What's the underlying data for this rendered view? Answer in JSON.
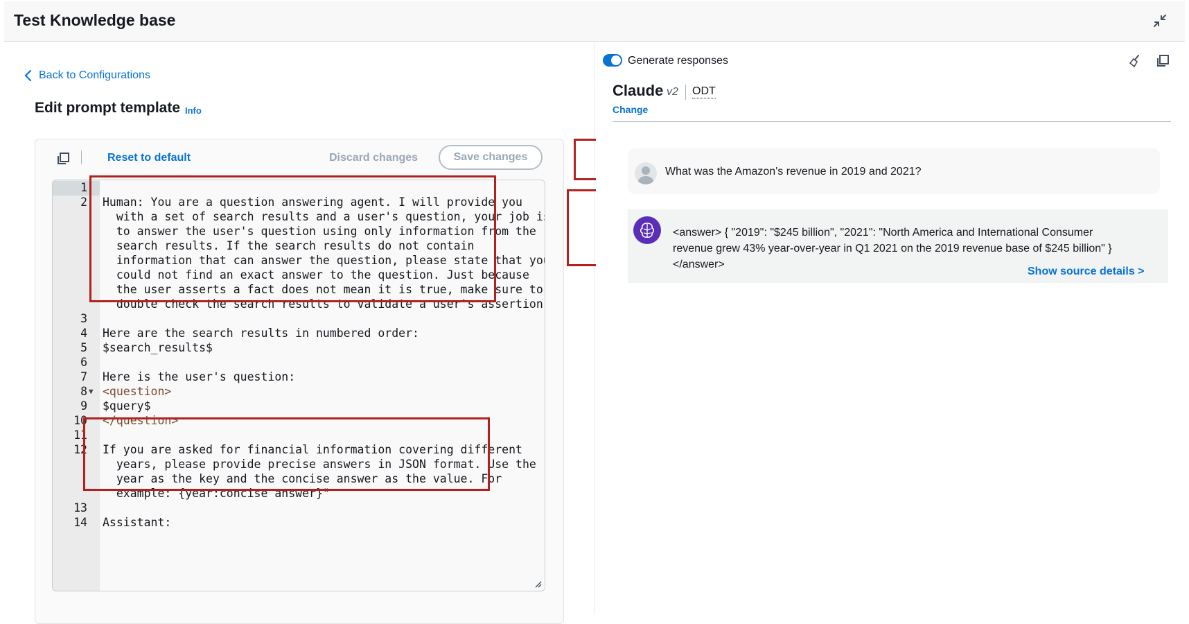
{
  "header": {
    "title": "Test Knowledge base"
  },
  "left": {
    "back_label": "Back to Configurations",
    "edit_title": "Edit prompt template",
    "info_label": "Info",
    "reset_label": "Reset to default",
    "discard_label": "Discard changes",
    "save_label": "Save changes"
  },
  "editor": {
    "lines": [
      {
        "n": "1",
        "text": ""
      },
      {
        "n": "2",
        "text": "Human: You are a question answering agent. I will provide you"
      },
      {
        "n": "",
        "text": "  with a set of search results and a user's question, your job is"
      },
      {
        "n": "",
        "text": "  to answer the user's question using only information from the"
      },
      {
        "n": "",
        "text": "  search results. If the search results do not contain"
      },
      {
        "n": "",
        "text": "  information that can answer the question, please state that you"
      },
      {
        "n": "",
        "text": "  could not find an exact answer to the question. Just because"
      },
      {
        "n": "",
        "text": "  the user asserts a fact does not mean it is true, make sure to"
      },
      {
        "n": "",
        "text": "  double check the search results to validate a user's assertion."
      },
      {
        "n": "3",
        "text": ""
      },
      {
        "n": "4",
        "text": "Here are the search results in numbered order:"
      },
      {
        "n": "5",
        "text": "$search_results$"
      },
      {
        "n": "6",
        "text": ""
      },
      {
        "n": "7",
        "text": "Here is the user's question:"
      },
      {
        "n": "8",
        "text": "<question>"
      },
      {
        "n": "9",
        "text": "$query$"
      },
      {
        "n": "10",
        "text": "</question>"
      },
      {
        "n": "11",
        "text": ""
      },
      {
        "n": "12",
        "text": "If you are asked for financial information covering different"
      },
      {
        "n": "",
        "text": "  years, please provide precise answers in JSON format. Use the"
      },
      {
        "n": "",
        "text": "  year as the key and the concise answer as the value. For"
      },
      {
        "n": "",
        "text": "  example: {year:concise answer}\""
      },
      {
        "n": "13",
        "text": ""
      },
      {
        "n": "14",
        "text": "Assistant:"
      }
    ]
  },
  "right": {
    "generate_label": "Generate responses",
    "model_name": "Claude",
    "model_version": "v2",
    "model_tag": "ODT",
    "change_label": "Change",
    "user_question": "What was the Amazon's revenue in 2019 and 2021?",
    "answer_line1": "<answer> { \"2019\": \"$245 billion\", \"2021\": \"North America and International Consumer",
    "answer_line2": "revenue grew 43% year-over-year in Q1 2021 on the 2019 revenue base of $245 billion\" }",
    "answer_line3": "</answer>",
    "source_label": "Show source details >"
  },
  "colors": {
    "accent": "#0972d3",
    "highlight": "#b1211e",
    "bot_avatar": "#5b2eb8"
  }
}
